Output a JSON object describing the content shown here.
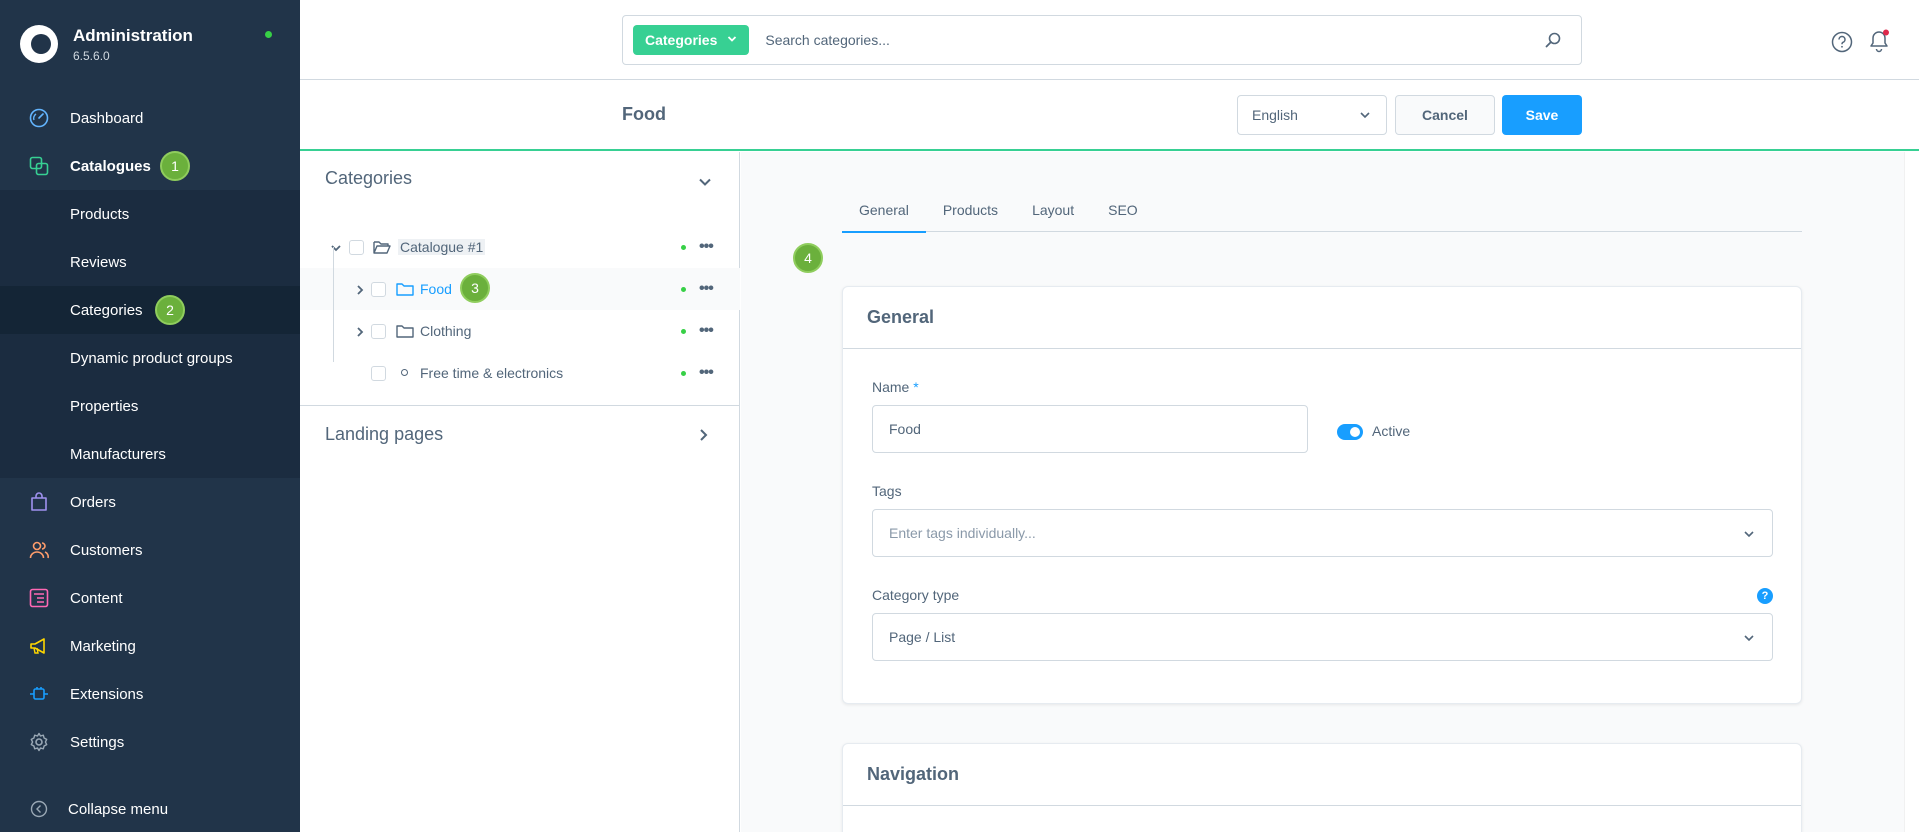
{
  "sidebar": {
    "brand_title": "Administration",
    "brand_version": "6.5.6.0",
    "nav": {
      "dashboard": "Dashboard",
      "catalogues": "Catalogues",
      "orders": "Orders",
      "customers": "Customers",
      "content": "Content",
      "marketing": "Marketing",
      "extensions": "Extensions",
      "settings": "Settings"
    },
    "sub": {
      "products": "Products",
      "reviews": "Reviews",
      "categories": "Categories",
      "dynamic_groups": "Dynamic product groups",
      "properties": "Properties",
      "manufacturers": "Manufacturers"
    },
    "collapse": "Collapse menu",
    "badges": [
      "1",
      "2",
      "3",
      "4"
    ]
  },
  "topbar": {
    "search_type": "Categories",
    "search_placeholder": "Search categories..."
  },
  "smartbar": {
    "title": "Food",
    "language": "English",
    "cancel": "Cancel",
    "save": "Save"
  },
  "tree": {
    "heading": "Categories",
    "rows": {
      "root": "Catalogue #1",
      "food": "Food",
      "clothing": "Clothing",
      "free_time": "Free time & electronics"
    },
    "landing_pages": "Landing pages"
  },
  "detail": {
    "tabs": [
      "General",
      "Products",
      "Layout",
      "SEO"
    ],
    "general_card": {
      "title": "General",
      "name_label": "Name",
      "name_required": "*",
      "name_value": "Food",
      "active_label": "Active",
      "tags_label": "Tags",
      "tags_placeholder": "Enter tags individually...",
      "category_type_label": "Category type",
      "category_type_value": "Page / List",
      "help": "?"
    },
    "navigation_card": {
      "title": "Navigation"
    }
  },
  "colors": {
    "sidebar_bg": "#213449",
    "accent_green": "#37d093",
    "primary_blue": "#189eff",
    "badge_green": "#6bb03c"
  }
}
